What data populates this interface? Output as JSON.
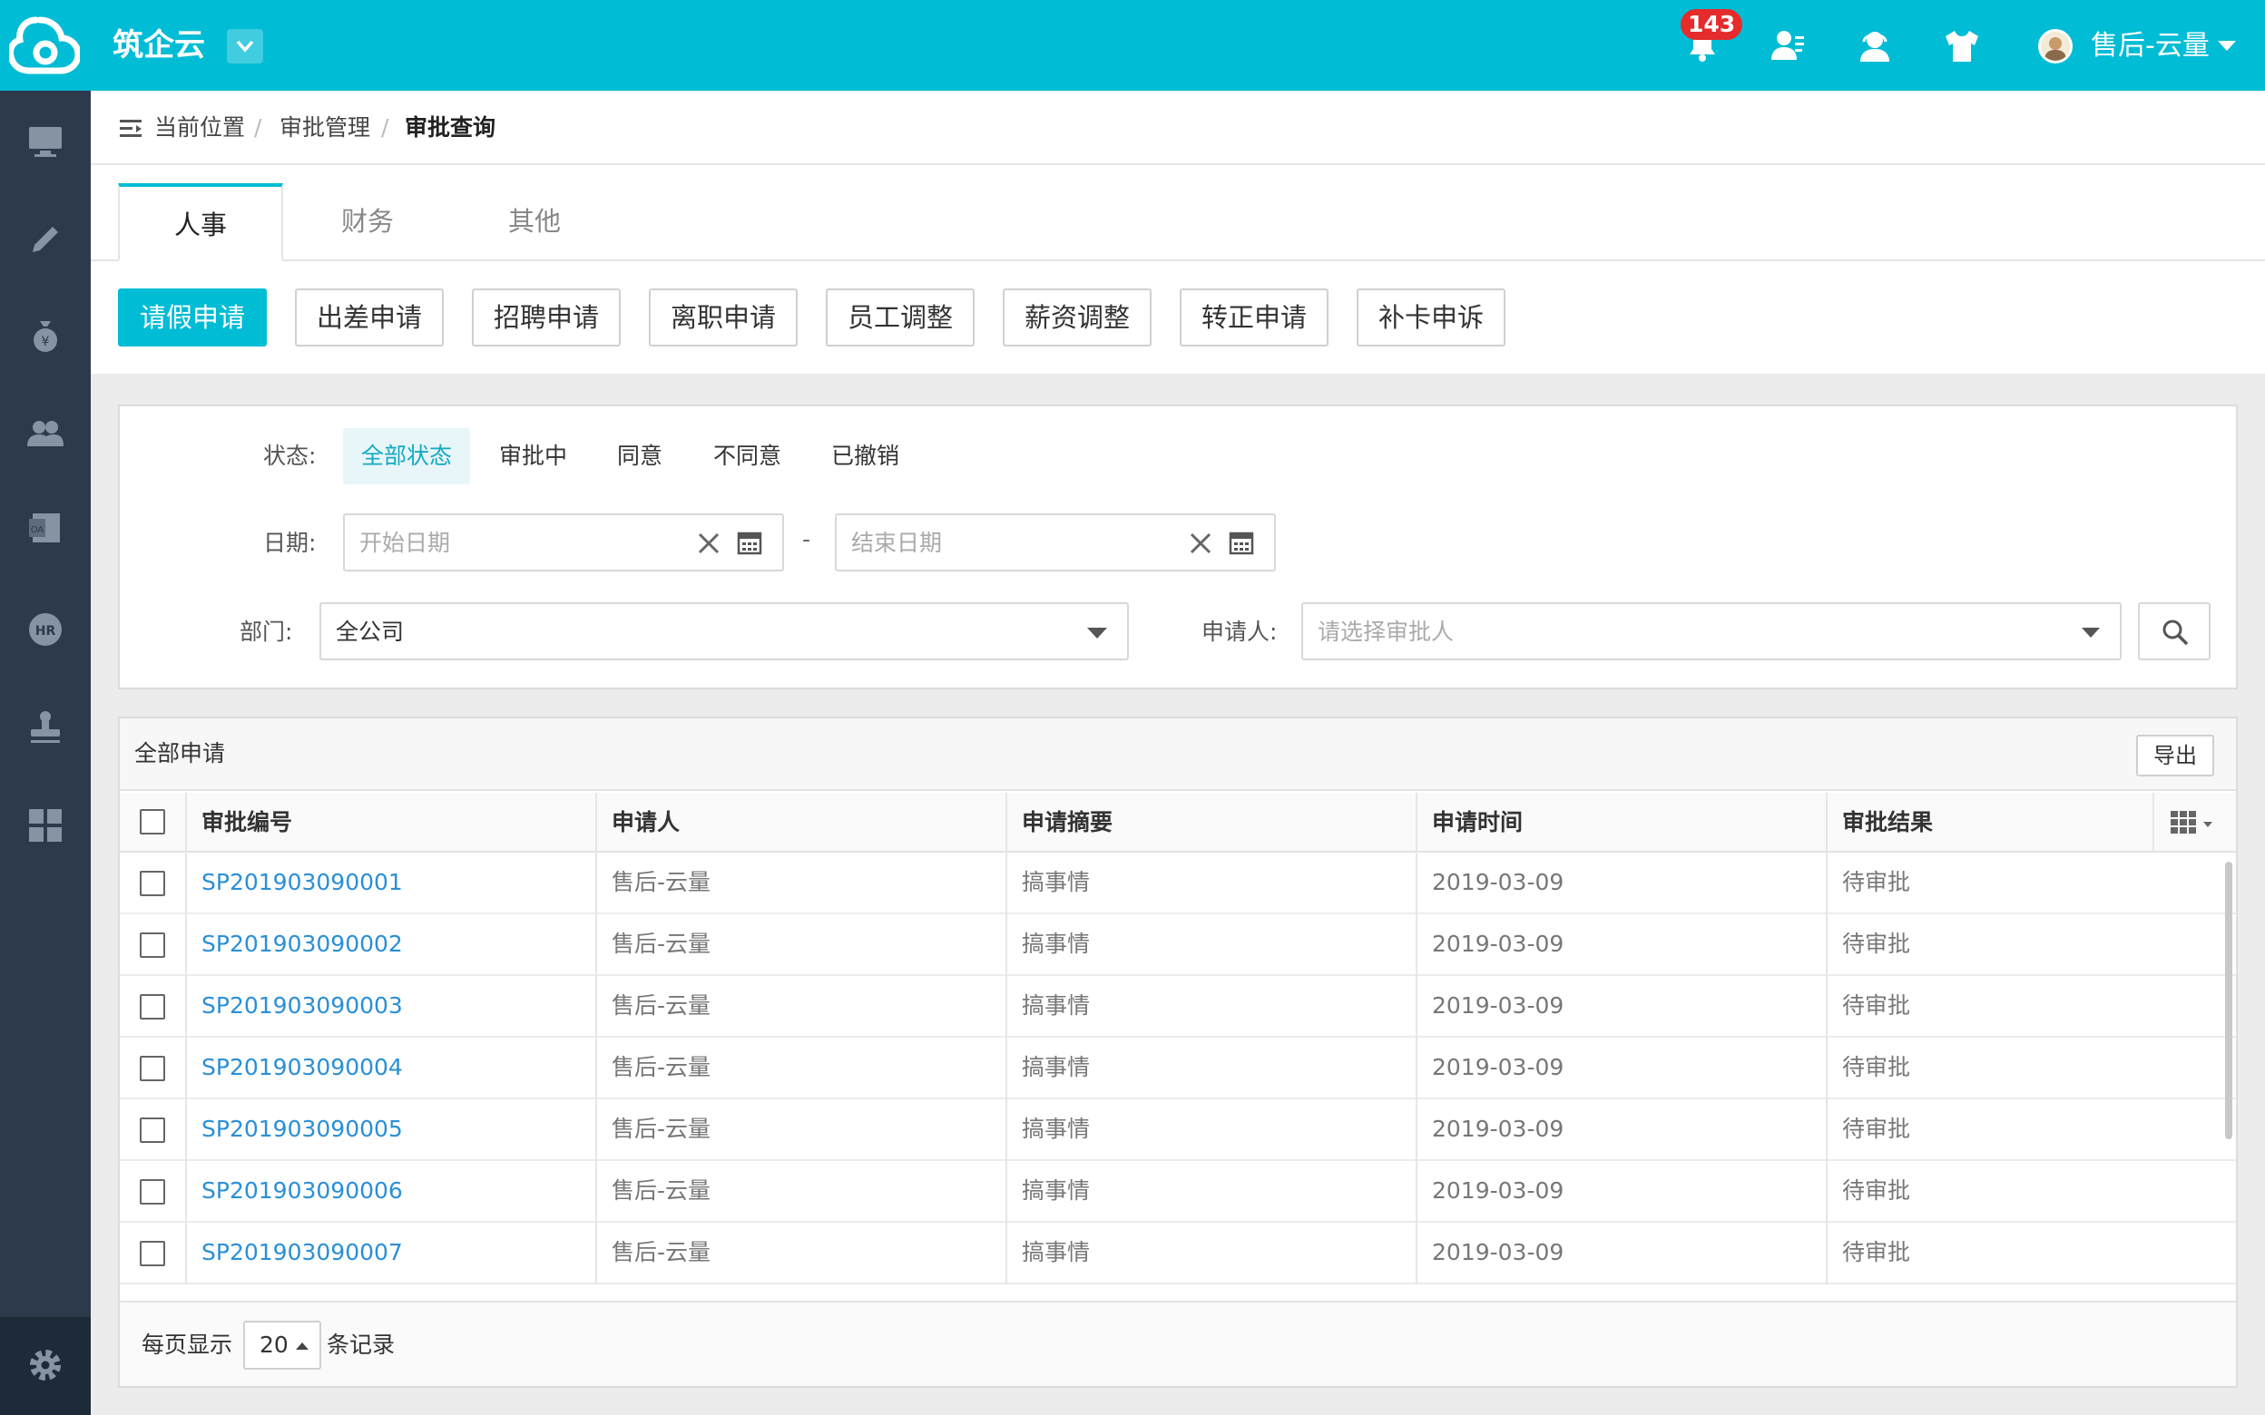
{
  "app": {
    "title": "筑企云",
    "notification_count": "143",
    "user_name": "售后-云量"
  },
  "sidebar": {
    "icons": [
      "monitor-icon",
      "pencil-icon",
      "money-bag-icon",
      "users-icon",
      "office-icon",
      "hr-icon",
      "stamp-icon",
      "grid-icon"
    ],
    "bottom_icon": "gear-icon"
  },
  "breadcrumb": {
    "items": [
      "当前位置",
      "审批管理",
      "审批查询"
    ],
    "separator": "/"
  },
  "tabs": [
    {
      "label": "人事",
      "active": true
    },
    {
      "label": "财务"
    },
    {
      "label": "其他"
    }
  ],
  "sub_buttons": [
    "请假申请",
    "出差申请",
    "招聘申请",
    "离职申请",
    "员工调整",
    "薪资调整",
    "转正申请",
    "补卡申诉"
  ],
  "filters": {
    "status_label": "状态:",
    "status_options": [
      "全部状态",
      "审批中",
      "同意",
      "不同意",
      "已撤销"
    ],
    "date_label": "日期:",
    "start_placeholder": "开始日期",
    "date_separator": "-",
    "end_placeholder": "结束日期",
    "dept_label": "部门:",
    "dept_value": "全公司",
    "applicant_label": "申请人:",
    "applicant_placeholder": "请选择审批人"
  },
  "table": {
    "title": "全部申请",
    "export_label": "导出",
    "columns": [
      "审批编号",
      "申请人",
      "申请摘要",
      "申请时间",
      "审批结果"
    ],
    "rows": [
      [
        "SP201903090001",
        "售后-云量",
        "搞事情",
        "2019-03-09",
        "待审批"
      ],
      [
        "SP201903090002",
        "售后-云量",
        "搞事情",
        "2019-03-09",
        "待审批"
      ],
      [
        "SP201903090003",
        "售后-云量",
        "搞事情",
        "2019-03-09",
        "待审批"
      ],
      [
        "SP201903090004",
        "售后-云量",
        "搞事情",
        "2019-03-09",
        "待审批"
      ],
      [
        "SP201903090005",
        "售后-云量",
        "搞事情",
        "2019-03-09",
        "待审批"
      ],
      [
        "SP201903090006",
        "售后-云量",
        "搞事情",
        "2019-03-09",
        "待审批"
      ],
      [
        "SP201903090007",
        "售后-云量",
        "搞事情",
        "2019-03-09",
        "待审批"
      ]
    ]
  },
  "pagination": {
    "prefix": "每页显示",
    "page_size": "20",
    "suffix": "条记录"
  },
  "colors": {
    "brand": "#00bcd4",
    "sidebar": "#2c3a4b",
    "link": "#2a8fd6",
    "badge": "#e52b2b"
  }
}
